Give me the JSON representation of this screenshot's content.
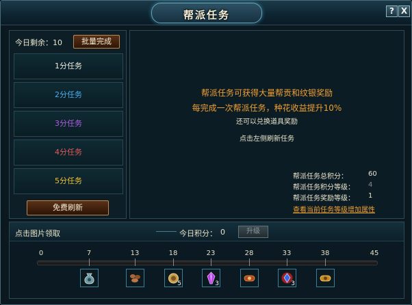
{
  "window": {
    "title": "帮派任务",
    "help_label": "?",
    "close_label": "X"
  },
  "left": {
    "remaining_label": "今日剩余：",
    "remaining_value": "10",
    "batch_complete": "批量完成",
    "tasks": [
      {
        "label": "1分任务",
        "color": "#f0ece0"
      },
      {
        "label": "2分任务",
        "color": "#4aaef0"
      },
      {
        "label": "3分任务",
        "color": "#b05ce8"
      },
      {
        "label": "4分任务",
        "color": "#e25a5a"
      },
      {
        "label": "5分任务",
        "color": "#f0c030"
      }
    ],
    "free_refresh": "免费刷新"
  },
  "right": {
    "line1": "帮派任务可获得大量帮贡和纹银奖励",
    "line2": "每完成一次帮派任务，种花收益提升10%",
    "line3": "还可以兑换道具奖励",
    "line4": "点击左侧刷新任务",
    "stats": [
      {
        "label": "帮派任务总积分：",
        "value": "60"
      },
      {
        "label": "帮派任务积分等级：",
        "value": "4"
      },
      {
        "label": "帮派任务奖励等级：",
        "value": "1"
      }
    ],
    "link": "查看当前任务等级增加属性"
  },
  "bottom": {
    "click_tip": "点击图片领取",
    "today_points_label": "今日积分：",
    "today_points_value": "0",
    "upgrade": "升级",
    "ticks": [
      "0",
      "7",
      "13",
      "18",
      "23",
      "28",
      "33",
      "38",
      "45"
    ],
    "rewards": [
      {
        "name": "money-bag-icon",
        "count": "",
        "color": "#7fb0b8"
      },
      {
        "name": "seeds-icon",
        "count": "",
        "color": "#b07040"
      },
      {
        "name": "coin-pouch-icon",
        "count": "5",
        "color": "#d8b060"
      },
      {
        "name": "purple-crystal-icon",
        "count": "3",
        "color": "#c050e0"
      },
      {
        "name": "fire-scroll-icon",
        "count": "",
        "color": "#d06030"
      },
      {
        "name": "blue-gem-icon",
        "count": "3",
        "color": "#3a6ae8"
      },
      {
        "name": "gold-scroll-icon",
        "count": "",
        "color": "#e0a030"
      }
    ]
  }
}
